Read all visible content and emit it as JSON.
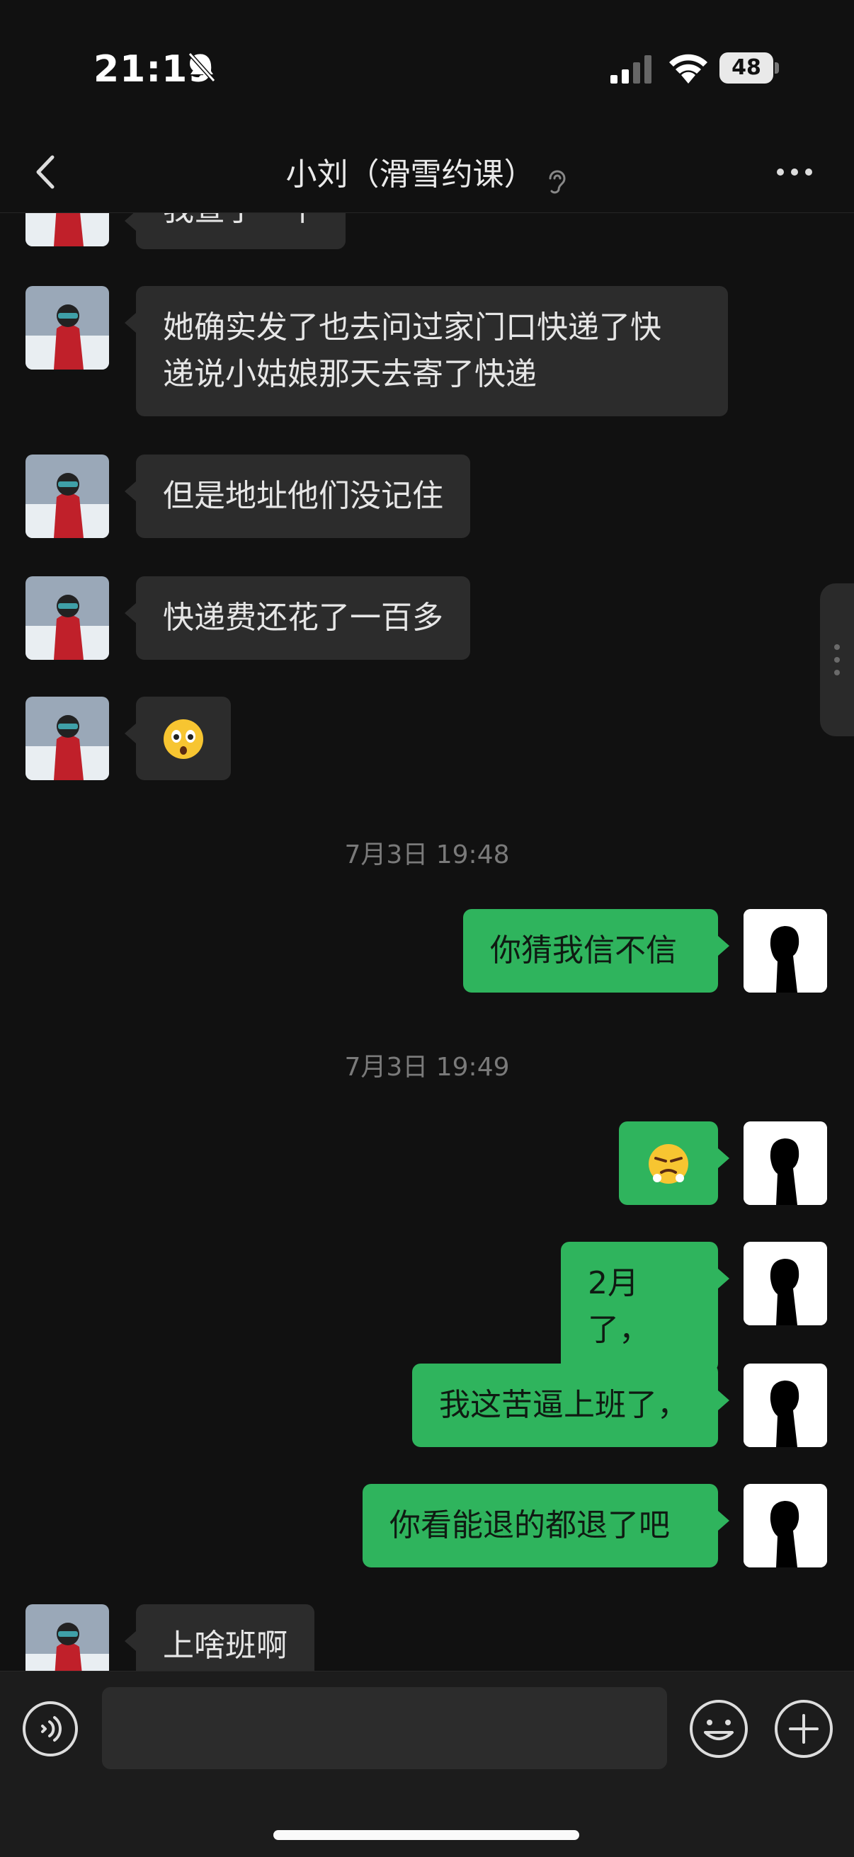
{
  "status_bar": {
    "time": "21:19",
    "battery": "48"
  },
  "nav": {
    "title": "小刘（滑雪约课）"
  },
  "messages": {
    "partial_top": "我查了一下",
    "m1": "她确实发了也去问过家门口快递了快递说小姑娘那天去寄了快递",
    "m1_line1": "她确实发了也去问过家门口快递了快",
    "m1_line2": "递说小姑娘那天去寄了快递",
    "m2": "但是地址他们没记住",
    "m3": "快递费还花了一百多",
    "m4_emoji": "🫨",
    "ts1": "7月3日 19:48",
    "m5": "你猜我信不信",
    "ts2": "7月3日 19:49",
    "m6_emoji": "😤",
    "m7": "2月了，",
    "m8": "我这苦逼上班了，",
    "m9": "你看能退的都退了吧",
    "m10": "上啥班啊"
  },
  "input": {
    "value": ""
  },
  "colors": {
    "outgoing_bubble": "#2fb45d",
    "incoming_bubble": "#2c2c2c",
    "background": "#111111"
  },
  "icons": [
    "bell-muted-icon",
    "signal-icon",
    "wifi-icon",
    "battery-icon",
    "back-icon",
    "ear-icon",
    "more-icon",
    "voice-icon",
    "emoji-icon",
    "plus-icon"
  ]
}
